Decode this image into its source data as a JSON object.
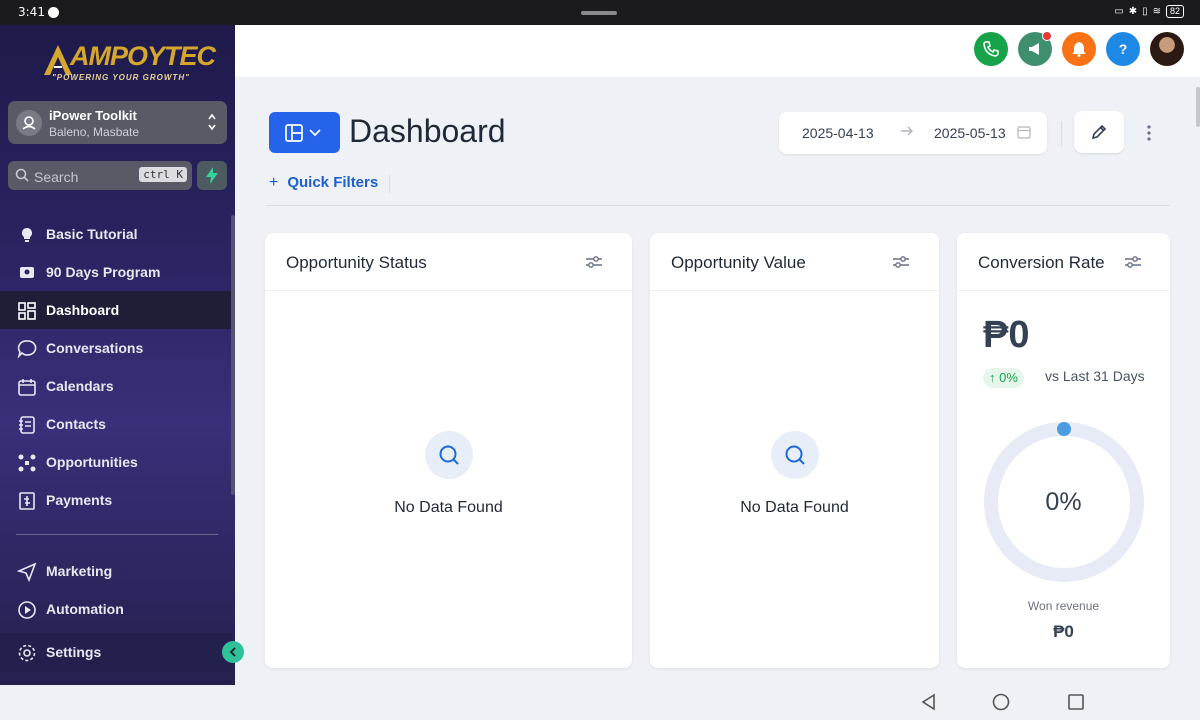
{
  "status_bar": {
    "time": "3:41",
    "battery": "82"
  },
  "brand": {
    "name": "AMPOYTEC",
    "tagline": "\"POWERING YOUR GROWTH\""
  },
  "account": {
    "name": "iPower Toolkit",
    "location": "Baleno, Masbate"
  },
  "search": {
    "placeholder": "Search",
    "shortcut": "ctrl K"
  },
  "sidebar": {
    "items": [
      {
        "label": "Basic Tutorial",
        "icon": "lightbulb-icon"
      },
      {
        "label": "90 Days Program",
        "icon": "graduation-icon"
      },
      {
        "label": "Dashboard",
        "icon": "grid-icon",
        "active": true
      },
      {
        "label": "Conversations",
        "icon": "chat-icon"
      },
      {
        "label": "Calendars",
        "icon": "calendar-icon"
      },
      {
        "label": "Contacts",
        "icon": "contacts-icon"
      },
      {
        "label": "Opportunities",
        "icon": "opportunities-icon"
      },
      {
        "label": "Payments",
        "icon": "payments-icon"
      }
    ],
    "secondary": [
      {
        "label": "Marketing",
        "icon": "send-icon"
      },
      {
        "label": "Automation",
        "icon": "automation-icon"
      }
    ],
    "settings_label": "Settings"
  },
  "colors": {
    "accent": "#2563eb",
    "call": "#17a34a",
    "announce": "#3f8f6f",
    "notify": "#f97316",
    "help": "#1e88e5"
  },
  "header": {
    "title": "Dashboard",
    "date_start": "2025-04-13",
    "date_end": "2025-05-13",
    "quick_filters": "Quick Filters"
  },
  "cards": {
    "opportunity_status": {
      "title": "Opportunity Status",
      "empty": "No Data Found"
    },
    "opportunity_value": {
      "title": "Opportunity Value",
      "empty": "No Data Found"
    },
    "conversion_rate": {
      "title": "Conversion Rate",
      "value": "₱0",
      "change": "↑ 0%",
      "comparison": "vs Last 31 Days",
      "percent_label": "0%",
      "percent_value": 0,
      "won_label": "Won revenue",
      "won_value": "₱0"
    }
  }
}
